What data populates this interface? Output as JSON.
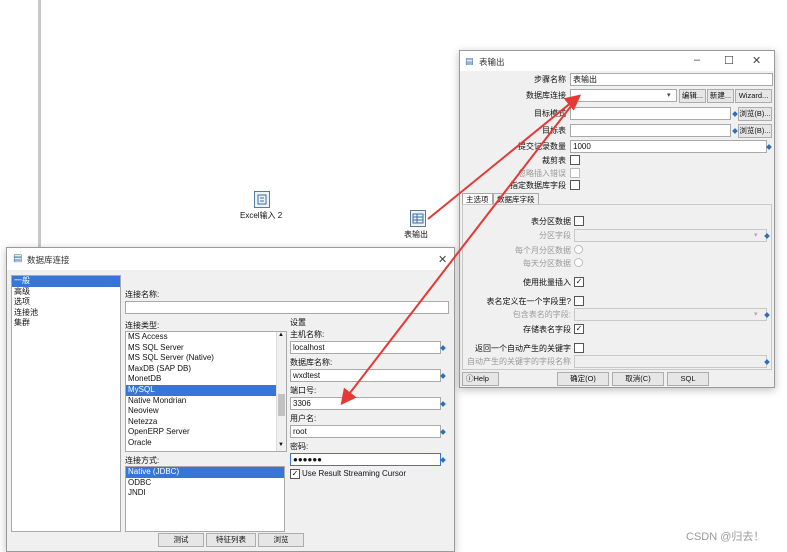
{
  "canvas": {
    "steps": [
      {
        "label": "Excel输入 2",
        "icon": "excel-input-icon"
      },
      {
        "label": "表输出",
        "icon": "table-output-icon"
      }
    ]
  },
  "table_output": {
    "title": "表输出",
    "fields": {
      "step_name_label": "步骤名称",
      "step_name_value": "表输出",
      "db_conn_label": "数据库连接",
      "db_conn_value": "",
      "target_schema_label": "目标模式",
      "target_table_label": "目标表",
      "commit_size_label": "提交记录数量",
      "commit_size_value": "1000",
      "truncate_label": "裁剪表",
      "ignore_errors_label": "忽略插入错误",
      "specify_fields_label": "指定数据库字段"
    },
    "buttons": {
      "edit": "编辑...",
      "new": "新建...",
      "wizard": "Wizard...",
      "browse1": "浏览(B)...",
      "browse2": "浏览(B)..."
    },
    "tabs": [
      "主选项",
      "数据库字段"
    ],
    "main_options": {
      "partition_label": "表分区数据",
      "partition_field_label": "分区字段",
      "monthly_label": "每个月分区数据",
      "daily_label": "每天分区数据",
      "batch_label": "使用批量插入",
      "table_in_field_label": "表名定义在一个字段里?",
      "table_name_field_label": "包含表名的字段:",
      "store_table_name_label": "存储表名字段",
      "return_key_label": "返回一个自动产生的关键字",
      "key_field_label": "自动产生的关键字的字段名称"
    },
    "footer": {
      "help": "Help",
      "ok": "确定(O)",
      "cancel": "取消(C)",
      "sql": "SQL"
    }
  },
  "db_connection": {
    "title": "数据库连接",
    "categories": [
      "一般",
      "高级",
      "选项",
      "连接池",
      "集群"
    ],
    "selected_category": 0,
    "conn_name_label": "连接名称:",
    "conn_type_label": "连接类型:",
    "conn_types": [
      "MS Access",
      "MS SQL Server",
      "MS SQL Server (Native)",
      "MaxDB (SAP DB)",
      "MonetDB",
      "MySQL",
      "Native Mondrian",
      "Neoview",
      "Netezza",
      "OpenERP Server",
      "Oracle"
    ],
    "selected_type": 5,
    "access_label": "连接方式:",
    "access_types": [
      "Native (JDBC)",
      "ODBC",
      "JNDI"
    ],
    "selected_access": 0,
    "settings_label": "设置",
    "host_label": "主机名称:",
    "host_value": "localhost",
    "dbname_label": "数据库名称:",
    "dbname_value": "wxdtest",
    "port_label": "端口号:",
    "port_value": "3306",
    "user_label": "用户名:",
    "user_value": "root",
    "password_label": "密码:",
    "password_value": "●●●●●●",
    "streaming_label": "Use Result Streaming Cursor",
    "buttons": {
      "test": "测试",
      "features": "特征列表",
      "explore": "浏览"
    }
  },
  "watermark": "CSDN @归去！"
}
